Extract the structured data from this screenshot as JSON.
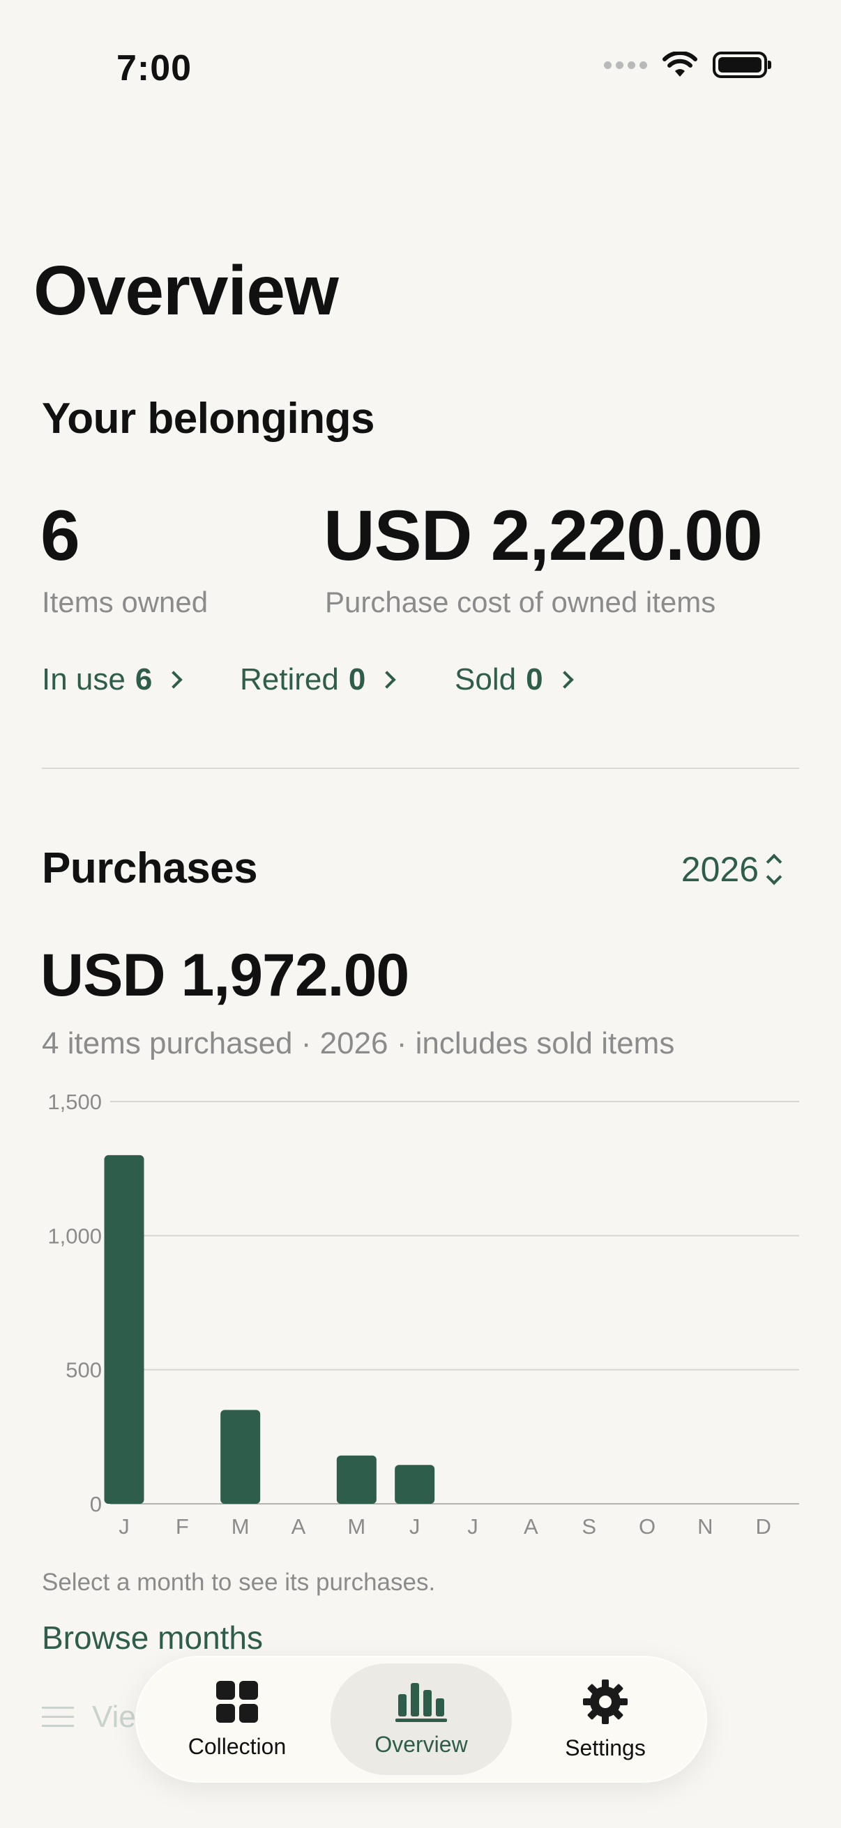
{
  "status": {
    "time": "7:00"
  },
  "page": {
    "title": "Overview"
  },
  "belongings": {
    "title": "Your belongings",
    "items_owned": "6",
    "items_owned_label": "Items owned",
    "cost": "USD 2,220.00",
    "cost_label": "Purchase cost of owned items",
    "links": [
      {
        "label": "In use",
        "count": "6"
      },
      {
        "label": "Retired",
        "count": "0"
      },
      {
        "label": "Sold",
        "count": "0"
      }
    ]
  },
  "purchases": {
    "title": "Purchases",
    "year": "2026",
    "total": "USD 1,972.00",
    "summary": "4 items purchased · 2026 · includes sold items",
    "hint": "Select a month to see its purchases.",
    "browse_label": "Browse months",
    "view_label": "View purchases"
  },
  "chart_data": {
    "type": "bar",
    "categories": [
      "J",
      "F",
      "M",
      "A",
      "M",
      "J",
      "J",
      "A",
      "S",
      "O",
      "N",
      "D"
    ],
    "values": [
      1300,
      0,
      350,
      0,
      180,
      145,
      0,
      0,
      0,
      0,
      0,
      0
    ],
    "yticks": [
      "0",
      "500",
      "1,000",
      "1,500"
    ],
    "ylim": [
      0,
      1500
    ],
    "bar_color": "#2f5d4b",
    "grid": true
  },
  "tabbar": {
    "tabs": [
      {
        "label": "Collection",
        "icon": "grid-icon",
        "active": false
      },
      {
        "label": "Overview",
        "icon": "chart-bars-icon",
        "active": true
      },
      {
        "label": "Settings",
        "icon": "gear-icon",
        "active": false
      }
    ]
  },
  "colors": {
    "accent": "#2f5d4b",
    "background": "#f7f6f2",
    "muted": "#8b8b8b"
  }
}
